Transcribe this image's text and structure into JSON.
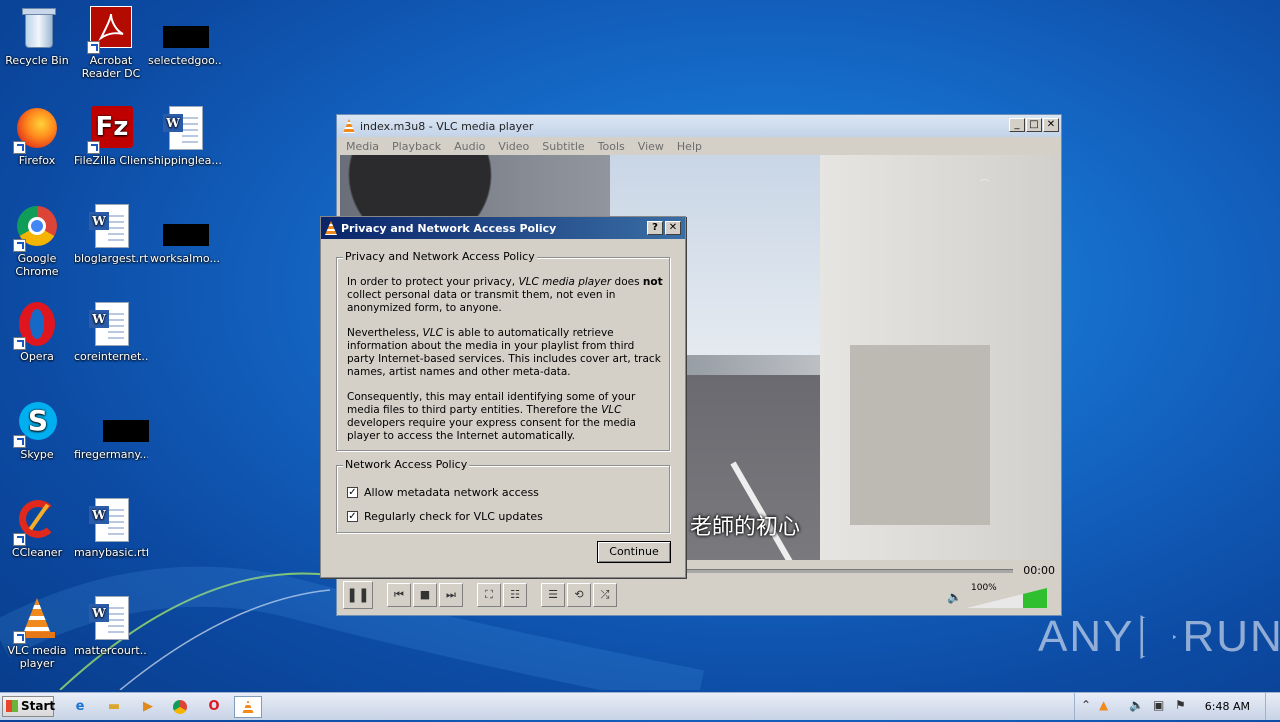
{
  "desktop": {
    "icons": [
      {
        "label": "Recycle Bin"
      },
      {
        "label": "Acrobat Reader DC"
      },
      {
        "label": "selectedgoo..."
      },
      {
        "label": "Firefox"
      },
      {
        "label": "FileZilla Client"
      },
      {
        "label": "shippinglea..."
      },
      {
        "label": "Google Chrome"
      },
      {
        "label": "bloglargest.rtf"
      },
      {
        "label": "worksalmo..."
      },
      {
        "label": "Opera"
      },
      {
        "label": "coreinternet..."
      },
      {
        "label": "Skype"
      },
      {
        "label": "firegermany..."
      },
      {
        "label": "CCleaner"
      },
      {
        "label": "manybasic.rtf"
      },
      {
        "label": "VLC media player"
      },
      {
        "label": "mattercourt..."
      }
    ]
  },
  "vlc": {
    "title": "index.m3u8 - VLC media player",
    "menu": [
      "Media",
      "Playback",
      "Audio",
      "Video",
      "Subtitle",
      "Tools",
      "View",
      "Help"
    ],
    "subtitle": "老師的初心",
    "time": "00:00",
    "volume": "100%",
    "volume_level": 1.0
  },
  "dialog": {
    "title": "Privacy and Network Access Policy",
    "help_btn": "?",
    "close_btn": "✕",
    "group1_title": "Privacy and Network Access Policy",
    "p1_a": "In order to protect your privacy, ",
    "p1_em": "VLC media player",
    "p1_b": " does ",
    "p1_strong": "not",
    "p1_c": " collect personal data or transmit them, not even in anonymized form, to anyone.",
    "p2_a": "Nevertheless, ",
    "p2_em": "VLC",
    "p2_b": " is able to automatically retrieve information about the media in your playlist from third party Internet-based services. This includes cover art, track names, artist names and other meta-data.",
    "p3_a": "Consequently, this may entail identifying some of your media files to third party entities. Therefore the ",
    "p3_em": "VLC",
    "p3_b": " developers require your express consent for the media player to access the Internet automatically.",
    "group2_title": "Network Access Policy",
    "check1": "Allow metadata network access",
    "check1_checked": true,
    "check2": "Regularly check for VLC updates",
    "check2_checked": true,
    "continue": "Continue"
  },
  "taskbar": {
    "start": "Start",
    "clock": "6:48 AM"
  },
  "watermark": {
    "left": "ANY",
    "right": "RUN"
  }
}
